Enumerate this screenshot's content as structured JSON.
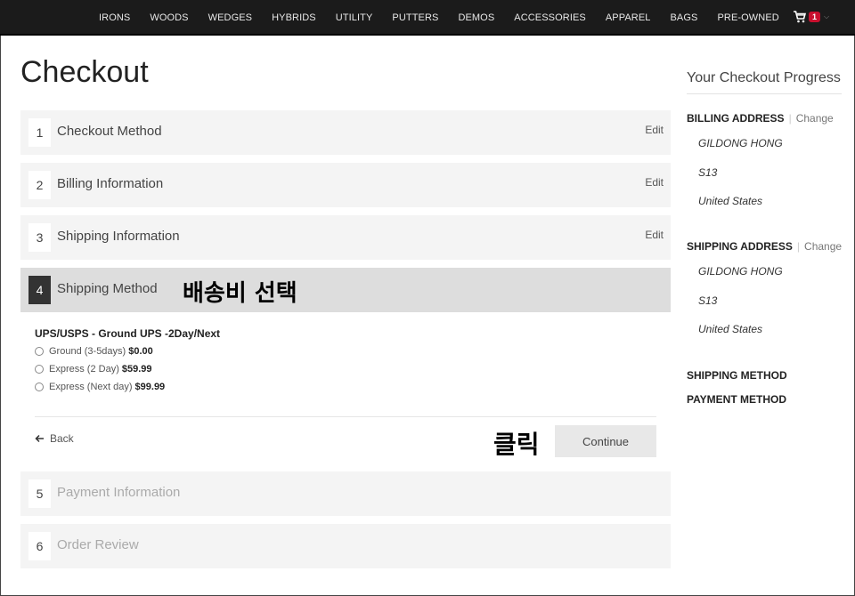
{
  "nav": {
    "links": [
      "IRONS",
      "WOODS",
      "WEDGES",
      "HYBRIDS",
      "UTILITY",
      "PUTTERS",
      "DEMOS",
      "ACCESSORIES",
      "APPAREL",
      "BAGS",
      "PRE-OWNED"
    ],
    "cart_count": "1",
    "cart_icon": "cart-icon"
  },
  "title": "Checkout",
  "steps": [
    {
      "num": "1",
      "label": "Checkout Method",
      "edit": "Edit"
    },
    {
      "num": "2",
      "label": "Billing Information",
      "edit": "Edit"
    },
    {
      "num": "3",
      "label": "Shipping Information",
      "edit": "Edit"
    },
    {
      "num": "4",
      "label": "Shipping Method"
    },
    {
      "num": "5",
      "label": "Payment Information"
    },
    {
      "num": "6",
      "label": "Order Review"
    }
  ],
  "annotations": {
    "select_shipping": "배송비 선택",
    "click": "클릭"
  },
  "shipping": {
    "carrier": "UPS/USPS - Ground UPS -2Day/Next",
    "options": [
      {
        "label": "Ground (3-5days)",
        "price": "$0.00"
      },
      {
        "label": "Express (2 Day)",
        "price": "$59.99"
      },
      {
        "label": "Express (Next day)",
        "price": "$99.99"
      }
    ],
    "back": "Back",
    "continue": "Continue"
  },
  "sidebar": {
    "title": "Your Checkout Progress",
    "billing": {
      "heading": "BILLING ADDRESS",
      "change": "Change",
      "lines": [
        "GILDONG HONG",
        "S13",
        "United States"
      ]
    },
    "shipping": {
      "heading": "SHIPPING ADDRESS",
      "change": "Change",
      "lines": [
        "GILDONG HONG",
        "S13",
        "United States"
      ]
    },
    "shipping_method": "SHIPPING METHOD",
    "payment_method": "PAYMENT METHOD"
  },
  "colors": {
    "nav_bg": "#1b1b1b",
    "badge": "#c8102e",
    "active_step": "#333333"
  }
}
